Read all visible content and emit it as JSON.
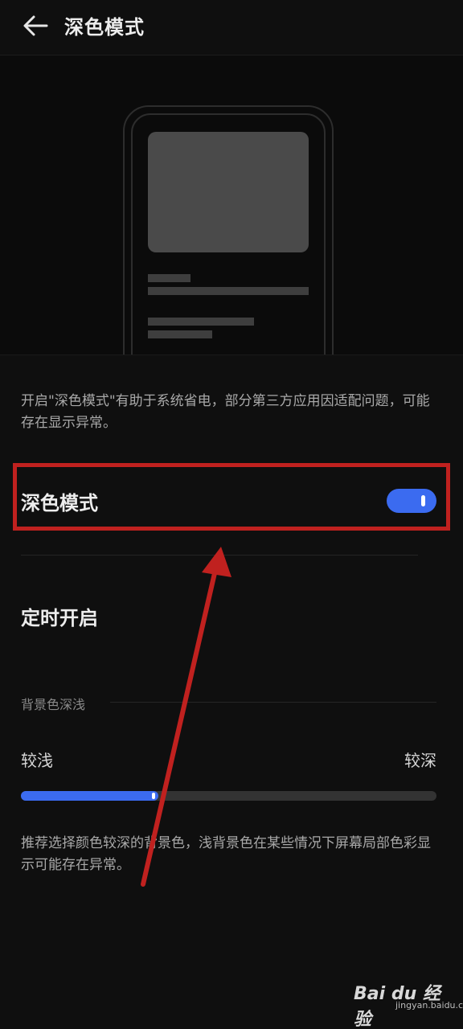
{
  "header": {
    "title": "深色模式",
    "back_icon": "arrow-left-icon"
  },
  "description": "开启\"深色模式\"有助于系统省电，部分第三方应用因适配问题，可能存在显示异常。",
  "dark_mode": {
    "label": "深色模式",
    "enabled": true
  },
  "schedule": {
    "label": "定时开启"
  },
  "background_depth": {
    "section_label": "背景色深浅",
    "left_label": "较浅",
    "right_label": "较深",
    "level": 0.33
  },
  "note": "推荐选择颜色较深的背景色，浅背景色在某些情况下屏幕局部色彩显示可能存在异常。",
  "watermark": {
    "logo": "Bai du 经验",
    "url": "jingyan.baidu.com"
  },
  "colors": {
    "accent": "#3b6bf0",
    "annotation": "#c0211f",
    "background": "#0f0f0f"
  }
}
